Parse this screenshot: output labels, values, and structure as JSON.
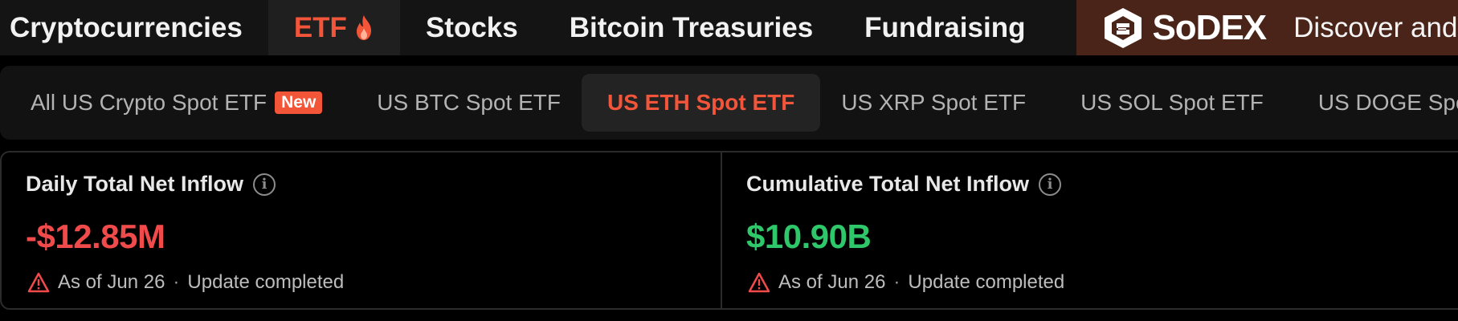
{
  "topnav": {
    "items": [
      {
        "label": "Cryptocurrencies"
      },
      {
        "label": "ETF"
      },
      {
        "label": "Stocks"
      },
      {
        "label": "Bitcoin Treasuries"
      },
      {
        "label": "Fundraising"
      }
    ],
    "active_index": 1,
    "ad": {
      "brand": "SoDEX",
      "text": "Discover and A"
    }
  },
  "subtabs": {
    "items": [
      {
        "label": "All US Crypto Spot ETF",
        "badge": "New"
      },
      {
        "label": "US BTC Spot ETF"
      },
      {
        "label": "US ETH Spot ETF"
      },
      {
        "label": "US XRP Spot ETF"
      },
      {
        "label": "US SOL Spot ETF"
      },
      {
        "label": "US DOGE Spot ETF"
      }
    ],
    "active_index": 2
  },
  "cards": [
    {
      "title": "Daily Total Net Inflow",
      "value": "-$12.85M",
      "as_of": "As of Jun 26",
      "separator": "·",
      "status": "Update completed"
    },
    {
      "title": "Cumulative Total Net Inflow",
      "value": "$10.90B",
      "as_of": "As of Jun 26",
      "separator": "·",
      "status": "Update completed"
    }
  ],
  "icons": {
    "fire": "fire-icon",
    "info": "info-icon",
    "warning": "warning-icon",
    "logo": "sodex-logo-icon"
  },
  "colors": {
    "accent": "#f2553a",
    "negative": "#f04a4a",
    "positive": "#2ec76a",
    "ad_background": "#4a2418"
  }
}
